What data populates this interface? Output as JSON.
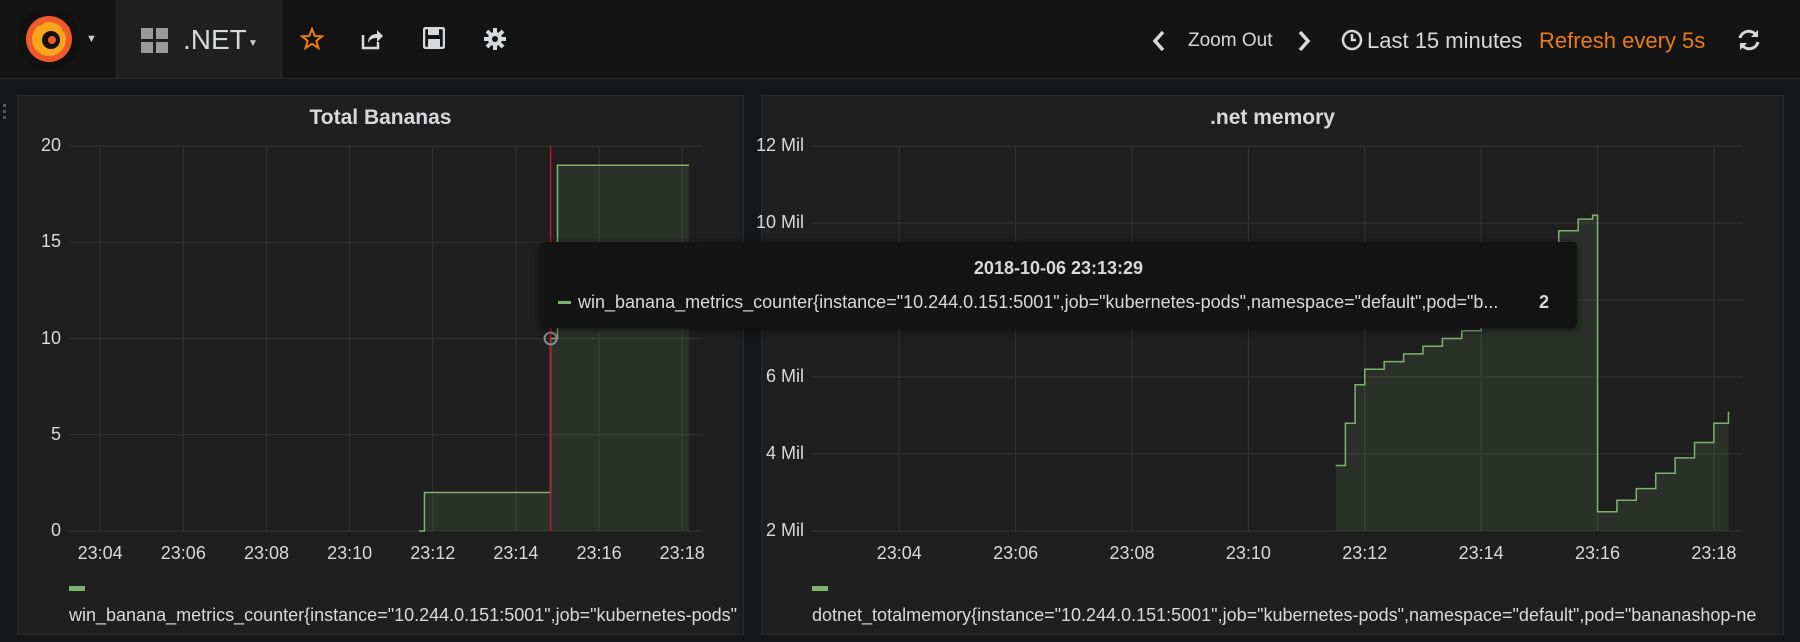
{
  "header": {
    "dashboard_title": ".NET",
    "zoom_out_label": "Zoom Out",
    "time_range_label": "Last 15 minutes",
    "refresh_label": "Refresh every 5s"
  },
  "icons": [
    "grafana-logo-icon",
    "chevron-down-icon",
    "dashboard-grid-icon",
    "star-icon",
    "share-icon",
    "save-icon",
    "gear-icon",
    "chevron-left-icon",
    "chevron-right-icon",
    "clock-icon",
    "refresh-icon"
  ],
  "colors": {
    "series": "#7eb26d",
    "accent": "#eb7b18",
    "crosshair": "#c4162a"
  },
  "tooltip": {
    "time": "2018-10-06 23:13:29",
    "series": "win_banana_metrics_counter{instance=\"10.244.0.151:5001\",job=\"kubernetes-pods\",namespace=\"default\",pod=\"b...",
    "value": "2"
  },
  "panels": [
    {
      "title": "Total Bananas",
      "y_ticks": [
        "20",
        "15",
        "10",
        "5",
        "0"
      ],
      "x_ticks": [
        "23:04",
        "23:06",
        "23:08",
        "23:10",
        "23:12",
        "23:14",
        "23:16",
        "23:18"
      ],
      "legend": "win_banana_metrics_counter{instance=\"10.244.0.151:5001\",job=\"kubernetes-pods\""
    },
    {
      "title": ".net memory",
      "y_ticks": [
        "12 Mil",
        "10 Mil",
        "8 Mil",
        "6 Mil",
        "4 Mil",
        "2 Mil"
      ],
      "x_ticks": [
        "23:04",
        "23:06",
        "23:08",
        "23:10",
        "23:12",
        "23:14",
        "23:16",
        "23:18"
      ],
      "legend": "dotnet_totalmemory{instance=\"10.244.0.151:5001\",job=\"kubernetes-pods\",namespace=\"default\",pod=\"bananashop-ne"
    }
  ],
  "chart_data": [
    {
      "type": "line",
      "title": "Total Bananas",
      "ylim": [
        0,
        20
      ],
      "x_ticks": [
        "23:04",
        "23:06",
        "23:08",
        "23:10",
        "23:12",
        "23:14",
        "23:16",
        "23:18"
      ],
      "series": [
        {
          "name": "win_banana_metrics_counter{instance=\"10.244.0.151:5001\",job=\"kubernetes-pods\"",
          "x": [
            "23:11:40",
            "23:11:48",
            "23:14:40",
            "23:14:50",
            "23:15:00",
            "23:18:10"
          ],
          "y": [
            0,
            2,
            2,
            10,
            19,
            19
          ]
        }
      ],
      "grid": true,
      "legend": "bottom"
    },
    {
      "type": "area",
      "title": ".net memory",
      "ylim": [
        2000000,
        12000000
      ],
      "x_ticks": [
        "23:04",
        "23:06",
        "23:08",
        "23:10",
        "23:12",
        "23:14",
        "23:16",
        "23:18"
      ],
      "series": [
        {
          "name": "dotnet_totalmemory{instance=\"10.244.0.151:5001\",job=\"kubernetes-pods\",namespace=\"default\",pod=\"bananashop-ne",
          "x": [
            "23:11:30",
            "23:11:40",
            "23:11:50",
            "23:12:00",
            "23:12:20",
            "23:12:40",
            "23:13:00",
            "23:13:20",
            "23:13:40",
            "23:14:00",
            "23:14:20",
            "23:14:40",
            "23:15:00",
            "23:15:20",
            "23:15:40",
            "23:15:55",
            "23:16:00",
            "23:16:20",
            "23:16:40",
            "23:17:00",
            "23:17:20",
            "23:17:40",
            "23:18:00",
            "23:18:15"
          ],
          "y": [
            3700000,
            4800000,
            5800000,
            6200000,
            6400000,
            6600000,
            6800000,
            7000000,
            7200000,
            7500000,
            8000000,
            8600000,
            9300000,
            9800000,
            10100000,
            10200000,
            2500000,
            2800000,
            3100000,
            3500000,
            3900000,
            4300000,
            4800000,
            5100000
          ]
        }
      ],
      "grid": true,
      "legend": "bottom"
    }
  ]
}
